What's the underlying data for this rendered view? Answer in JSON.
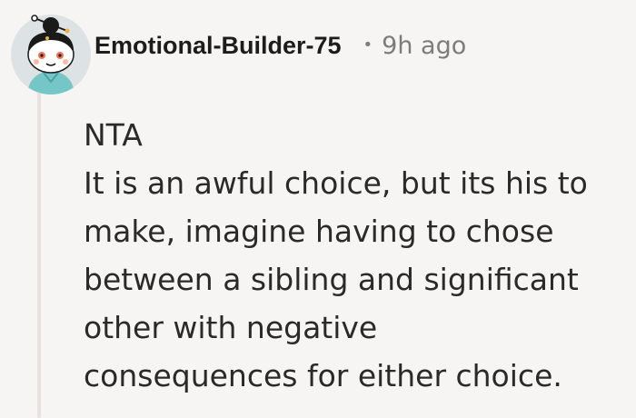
{
  "comment": {
    "author": "Emotional-Builder-75",
    "separator": "•",
    "timestamp": "9h ago",
    "avatar": {
      "icon": "reddit-snoo-avatar-icon",
      "colors": {
        "background": "#dde3e5",
        "body": "#ffffff",
        "hair": "#1a1a1a",
        "outfit": "#74c7c6",
        "cheeks": "#f27455"
      }
    },
    "body_lines": [
      "NTA",
      "It is an awful choice, but its his to",
      "make, imagine having to chose",
      "between a sibling and significant",
      "other with negative",
      "consequences for either choice."
    ]
  },
  "colors": {
    "background": "#f7f5f3",
    "thread_line": "#e7e2de",
    "username": "#1c1c1c",
    "meta": "#7c7c7c",
    "text": "#2a2a2a"
  }
}
